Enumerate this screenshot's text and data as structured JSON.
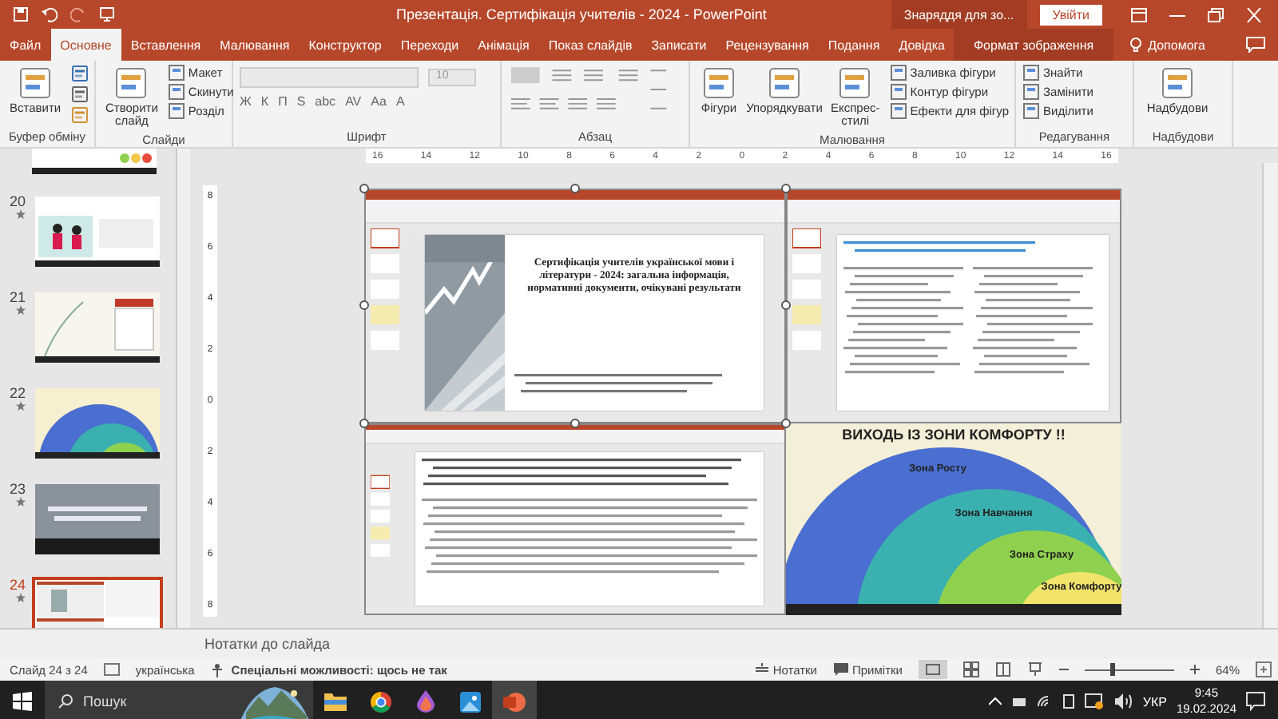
{
  "window": {
    "title": "Презентація. Сертифікація учителів - 2024 - PowerPoint",
    "context_label": "Знаряддя для зо...",
    "sign_in": "Увійти"
  },
  "tabs": [
    {
      "label": "Файл",
      "selected": false,
      "kind": "normal"
    },
    {
      "label": "Основне",
      "selected": true,
      "kind": "normal"
    },
    {
      "label": "Вставлення",
      "selected": false,
      "kind": "normal"
    },
    {
      "label": "Малювання",
      "selected": false,
      "kind": "normal"
    },
    {
      "label": "Конструктор",
      "selected": false,
      "kind": "normal"
    },
    {
      "label": "Переходи",
      "selected": false,
      "kind": "normal"
    },
    {
      "label": "Анімація",
      "selected": false,
      "kind": "normal"
    },
    {
      "label": "Показ слайдів",
      "selected": false,
      "kind": "normal"
    },
    {
      "label": "Записати",
      "selected": false,
      "kind": "normal"
    },
    {
      "label": "Рецензування",
      "selected": false,
      "kind": "normal"
    },
    {
      "label": "Подання",
      "selected": false,
      "kind": "normal"
    },
    {
      "label": "Довідка",
      "selected": false,
      "kind": "normal"
    },
    {
      "label": "Формат зображення",
      "selected": false,
      "kind": "contextual"
    }
  ],
  "help": "Допомога",
  "ribbon": {
    "groups": [
      {
        "label": "Буфер обміну",
        "items": [
          {
            "kind": "large",
            "label": "Вставити"
          },
          {
            "kind": "icons"
          }
        ]
      },
      {
        "label": "Слайди",
        "items": [
          {
            "kind": "large",
            "label": "Створити слайд"
          },
          {
            "kind": "smalls",
            "labels": [
              "Макет",
              "Скинути",
              "Розділ"
            ]
          }
        ]
      },
      {
        "label": "Шрифт",
        "items": [
          {
            "kind": "font",
            "size": "10",
            "buttons": [
              "Ж",
              "К",
              "П",
              "S",
              "abc",
              "AV",
              "Aa",
              "A"
            ]
          }
        ]
      },
      {
        "label": "Абзац",
        "items": [
          {
            "kind": "paragraph"
          }
        ]
      },
      {
        "label": "Малювання",
        "items": [
          {
            "kind": "large",
            "label": "Фігури"
          },
          {
            "kind": "large",
            "label": "Упорядкувати"
          },
          {
            "kind": "large",
            "label": "Експрес-стилі"
          },
          {
            "kind": "smalls",
            "labels": [
              "Заливка фігури",
              "Контур фігури",
              "Ефекти для фігур"
            ]
          }
        ]
      },
      {
        "label": "Редагування",
        "items": [
          {
            "kind": "smalls",
            "labels": [
              "Знайти",
              "Замінити",
              "Виділити"
            ]
          }
        ]
      },
      {
        "label": "Надбудови",
        "items": [
          {
            "kind": "large",
            "label": "Надбудови"
          }
        ]
      }
    ]
  },
  "ruler": {
    "horizontal": [
      "16",
      "14",
      "12",
      "10",
      "8",
      "6",
      "4",
      "2",
      "0",
      "2",
      "4",
      "6",
      "8",
      "10",
      "12",
      "14",
      "16"
    ],
    "vertical": [
      "8",
      "6",
      "4",
      "2",
      "0",
      "2",
      "4",
      "6",
      "8"
    ]
  },
  "thumbnails": [
    {
      "number": "20",
      "selected": false,
      "kind": "people"
    },
    {
      "number": "21",
      "selected": false,
      "kind": "note"
    },
    {
      "number": "22",
      "selected": false,
      "kind": "zones"
    },
    {
      "number": "23",
      "selected": false,
      "kind": "dark"
    },
    {
      "number": "24",
      "selected": true,
      "kind": "collage"
    }
  ],
  "slide": {
    "title_slide": "Сертифікація учителів української мови і літератури - 2024: загальна інформація, нормативні документи, очікувані результати",
    "zones_title": "ВИХОДЬ ІЗ ЗОНИ КОМФОРТУ !!",
    "zones": [
      {
        "label": "Зона Росту",
        "color": "#4a6fd0"
      },
      {
        "label": "Зона Навчання",
        "color": "#3bb0b0"
      },
      {
        "label": "Зона Страху",
        "color": "#8fd14f"
      },
      {
        "label": "Зона Комфорту",
        "color": "#f2e36b"
      }
    ]
  },
  "notes_placeholder": "Нотатки до слайда",
  "status_bar": {
    "slide": "Слайд 24 з 24",
    "language": "українська",
    "accessibility": "Спеціальні можливості: щось не так",
    "notes": "Нотатки",
    "comments": "Примітки",
    "zoom": "64%",
    "level": 0.3
  },
  "taskbar": {
    "search": "Пошук",
    "language": "УКР",
    "time": "9:45",
    "date": "19.02.2024"
  }
}
